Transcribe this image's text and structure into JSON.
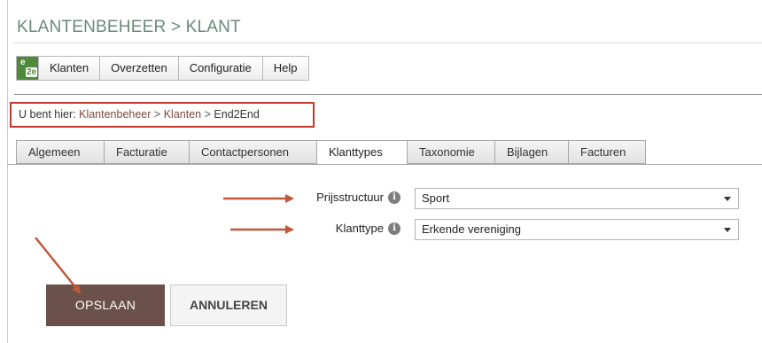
{
  "page": {
    "title": "KLANTENBEHEER > KLANT"
  },
  "menu": {
    "logo_top": "e",
    "logo_bottom": "2e",
    "items": [
      "Klanten",
      "Overzetten",
      "Configuratie",
      "Help"
    ]
  },
  "breadcrumb": {
    "prefix": "U bent hier:",
    "crumbs": [
      "Klantenbeheer",
      "Klanten",
      "End2End"
    ],
    "separator": ">"
  },
  "tabs": {
    "items": [
      "Algemeen",
      "Facturatie",
      "Contactpersonen",
      "Klanttypes",
      "Taxonomie",
      "Bijlagen",
      "Facturen"
    ],
    "active": "Klanttypes"
  },
  "form": {
    "prijsstructuur": {
      "label": "Prijsstructuur",
      "info": "i",
      "value": "Sport"
    },
    "klanttype": {
      "label": "Klanttype",
      "info": "i",
      "value": "Erkende vereniging"
    }
  },
  "buttons": {
    "save": "OPSLAAN",
    "cancel": "ANNULEREN"
  },
  "colors": {
    "title": "#6a8a78",
    "highlight_box": "#c0392b",
    "annotation_arrow": "#c0583b",
    "save_button": "#6b5149"
  },
  "icons": {
    "logo": "e2e-logo-icon",
    "info": "info-circle-icon",
    "dropdown": "chevron-down-icon",
    "annotation": "arrow-right-icon"
  }
}
